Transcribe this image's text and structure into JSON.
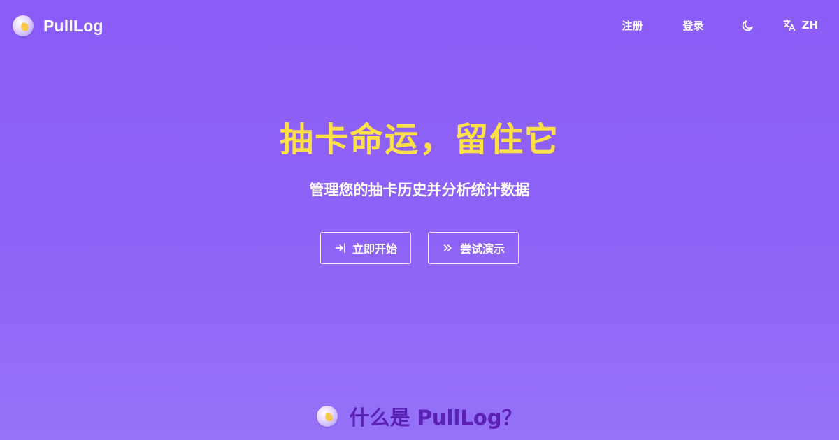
{
  "header": {
    "brand": "PullLog",
    "nav": {
      "signup": "注册",
      "login": "登录",
      "language": "ZH"
    },
    "icons": {
      "theme": "moon-icon",
      "language": "translate-icon"
    }
  },
  "hero": {
    "title": "抽卡命运，留住它",
    "subtitle": "管理您的抽卡历史并分析统计数据",
    "buttons": {
      "start": "立即开始",
      "demo": "尝试演示"
    },
    "icons": {
      "start": "login-icon",
      "demo": "chevrons-right-icon"
    }
  },
  "section": {
    "title": "什么是 PullLog？"
  },
  "colors": {
    "background": "#8b5cf6",
    "title": "#fde047",
    "section_title": "#5b21b6"
  }
}
